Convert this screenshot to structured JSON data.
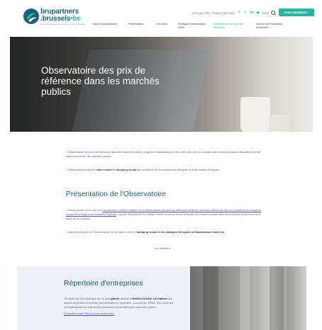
{
  "header": {
    "logo_line1": "bru",
    "logo_line1b": "partners",
    "logo_line2": ".brussels",
    "logo_line2b": "•be",
    "logo_tagline": "le site des entreprises au service de la région bruxelloise",
    "utility_links": [
      "ACTUALITÉS",
      "PUBLICATIONS"
    ],
    "social_icons": [
      "f",
      "t",
      "in",
      "▶"
    ],
    "language": "FR ▾",
    "member_button": "ZONE MEMBRES",
    "nav_items": [
      "Avis et contributions",
      "Présentation",
      "Services",
      "Stratégie Goldbrussels 2030",
      "Observatoire des prix de référence",
      "Service de Facilitation sectorielle"
    ],
    "active_nav": 4
  },
  "hero": {
    "title": "Observatoire des prix de référence dans les marchés publics"
  },
  "intro": {
    "p1": "L'Observatoire des prix de référence dans les marchés publics (ci-après l'Observatoire) a été créé pour offrir un soutien aux acheteurs publics bruxellois lors de leurs procédures de marchés publics.",
    "p2_pre": "L'Observatoire entend à ",
    "p2_bold": "lutter contre le dumping social",
    "p2_post": " qui consiste à de la concurrence déloyale et à des pertes d'emplois."
  },
  "presentation": {
    "title": "Présentation de l'Observatoire",
    "p3_pre": "L'Observatoire a été créé par ",
    "p3_link": "l'ordonnance portant création d'un Observatoire des prix de référence dans les marchés publics au sein du Conseil économique et social de la Région de Bruxelles-Capitale",
    "p3_post": ". Depuis, Brupartners l'a relayé d'éviter la concurrence déloyale et la fraude sociale dans les marchés publics sont à la base de sa création.",
    "p4_pre": "L'objectif principal de l'Observatoire est de lutter contre le ",
    "p4_bold": "dumping social et les pratiques déloyales et frauduleuses dans les",
    "read_more": "Lire la suite ▸"
  },
  "repertoire": {
    "title": "Répertoire d'entreprises",
    "p1_pre": "Le répertoire d'entreprises est un outil ",
    "p1_bold": "gratuit",
    "p1_mid": " destiné à ",
    "p1_bold2": "faciliter la mise en relation",
    "p1_post": " des acheteurs publics bruxellois (administrations régionales, communes, CPAS, etc.) avec les entreprises actives à Bruxelles (inclusive répertoriées pour marchés publics.",
    "p2_link": "Consultez notre FAQ pour en savoir plus."
  },
  "colors": {
    "brand_dark": "#1d5f77",
    "brand_green": "#2bb39b",
    "link_purple": "#5a4fa0"
  }
}
